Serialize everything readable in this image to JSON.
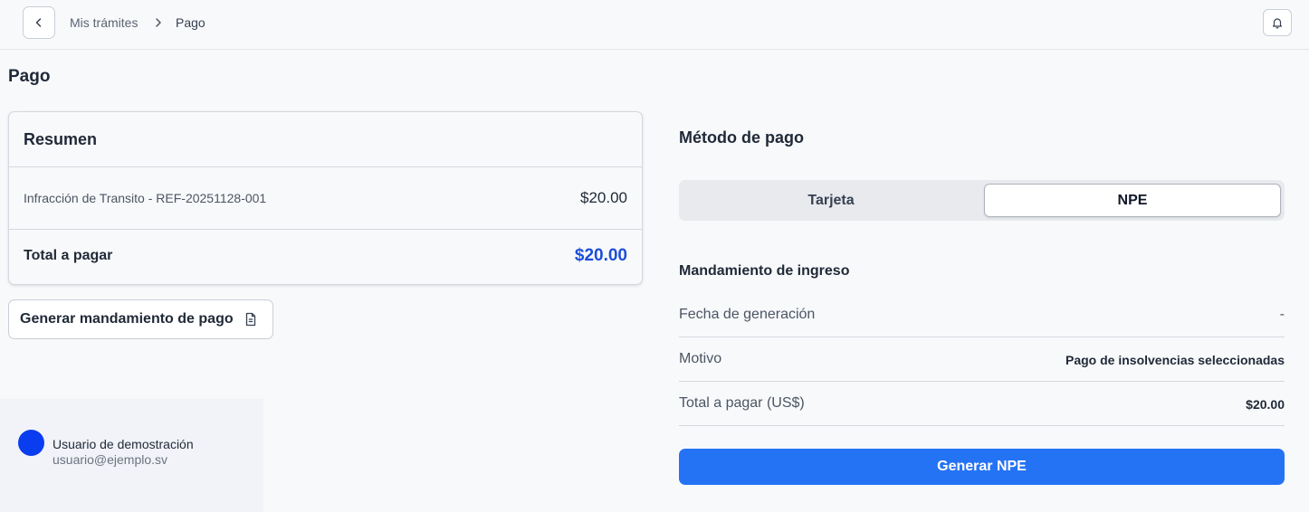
{
  "header": {
    "breadcrumb": [
      "Mis trámites",
      "Pago"
    ]
  },
  "page": {
    "title": "Pago"
  },
  "summary": {
    "title": "Resumen",
    "item_label": "Infracción de Transito - REF-20251128-001",
    "item_amount": "$20.00",
    "total_label": "Total a pagar",
    "total_amount": "$20.00"
  },
  "actions": {
    "generate_order_label": "Generar mandamiento de pago"
  },
  "user": {
    "name": "Usuario de demostración",
    "email": "usuario@ejemplo.sv"
  },
  "payment": {
    "title": "Método de pago",
    "tabs": [
      "Tarjeta",
      "NPE"
    ],
    "selected_tab": "NPE",
    "order_title": "Mandamiento de ingreso",
    "rows": [
      {
        "label": "Fecha de generación",
        "value": "-"
      },
      {
        "label": "Motivo",
        "value": "Pago de insolvencias seleccionadas"
      },
      {
        "label": "Total a pagar (US$)",
        "value": "$20.00"
      }
    ],
    "generate_npe_label": "Generar NPE"
  },
  "colors": {
    "accent": "#2573f5",
    "total_amount": "#1d4ed8",
    "avatar": "#0b3df0"
  },
  "icons": [
    "chevron-left-icon",
    "chevron-right-icon",
    "bell-icon",
    "document-icon"
  ]
}
